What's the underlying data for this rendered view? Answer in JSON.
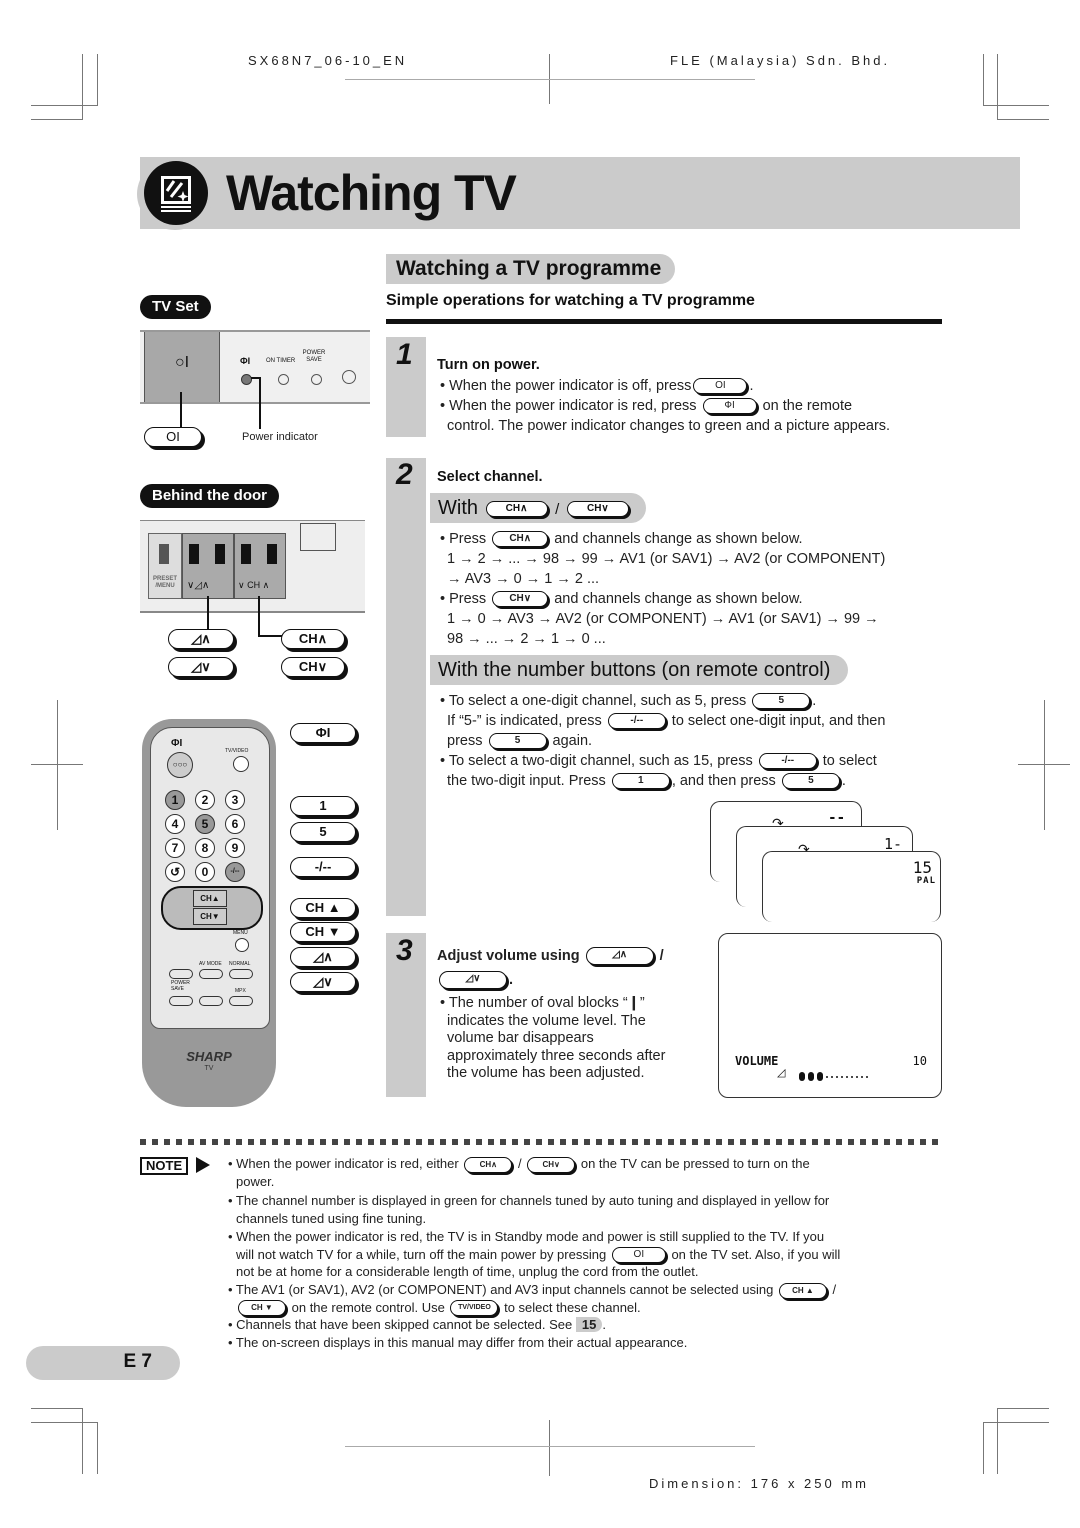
{
  "header": {
    "doc_code": "SX68N7_06-10_EN",
    "company": "FLE (Malaysia) Sdn. Bhd."
  },
  "banner": {
    "title": "Watching TV",
    "icon": "tv-guide-icon"
  },
  "section": {
    "title": "Watching a TV programme",
    "subtitle": "Simple operations for watching a TV programme"
  },
  "left": {
    "tv_set_label": "TV Set",
    "panel_labels": {
      "power": "○I",
      "standby": "ФI",
      "on_timer": "ON TIMER",
      "power_save": "POWER SAVE"
    },
    "main_power_key": "OI",
    "power_indicator_label": "Power indicator",
    "behind_door_label": "Behind the door",
    "door_labels": {
      "preset_menu": "PRESET /MENU",
      "vol": "∨◿∧",
      "ch": "∨ CH ∧"
    },
    "door_callouts": [
      "◿∧",
      "◿∨",
      "CH∧",
      "CH∨"
    ],
    "remote": {
      "standby": "ФI",
      "tv_video": "TV/VIDEO",
      "digits": [
        "1",
        "2",
        "3",
        "4",
        "5",
        "6",
        "7",
        "8",
        "9",
        "↺",
        "0",
        "-/--"
      ],
      "ch_up": "CH▲",
      "ch_down": "CH▼",
      "menu": "MENU",
      "mute": "🔇",
      "av_mode": "AV MODE",
      "normal": "NORMAL",
      "power_save": "POWER SAVE",
      "mpx": "MPX",
      "brand": "SHARP",
      "brand_sub": "TV"
    },
    "remote_callouts": [
      "ФI",
      "1",
      "5",
      "-/--",
      "CH ▲",
      "CH ▼",
      "◿∧",
      "◿∨"
    ]
  },
  "steps": [
    {
      "number": "1",
      "title": "Turn on power.",
      "lines": [
        {
          "pre": "• When the power indicator is off, press",
          "key": "OI",
          "post": "."
        },
        {
          "pre": "• When the power indicator is red, press",
          "key": "ФI",
          "post": "on the remote"
        },
        {
          "pre": "control. The power indicator changes to green and a picture appears.",
          "key": "",
          "post": ""
        }
      ]
    },
    {
      "number": "2",
      "title": "Select channel.",
      "with_bar": {
        "label": "With",
        "key1": "CH∧",
        "sep": "/",
        "key2": "CH∨"
      },
      "up_text": {
        "pre": "• Press",
        "key": "CH∧",
        "post": "and channels change as shown below."
      },
      "up_seq_1": "1 → 2 →  ... → 98 → 99 → AV1 (or SAV1) → AV2 (or COMPONENT)",
      "up_seq_2": "→ AV3 → 0 → 1 → 2 ...",
      "down_text": {
        "pre": "• Press",
        "key": "CH∨",
        "post": "and channels change as shown below."
      },
      "down_seq_1": "1 → 0 →  AV3 → AV2 (or COMPONENT) → AV1 (or SAV1)  → 99 →",
      "down_seq_2": "98 → ... → 2 → 1 → 0 ...",
      "number_bar": "With the number buttons (on remote control)",
      "num_lines": [
        {
          "pre": "• To select a one-digit channel, such as 5, press",
          "key": "5",
          "post": "."
        },
        {
          "pre": "If “5-” is indicated, press",
          "key": "-/--",
          "post": "to select one-digit input, and then"
        },
        {
          "pre": "press",
          "key": "5",
          "post": "again."
        },
        {
          "pre": "• To select a two-digit channel, such as 15, press",
          "key": "-/--",
          "post": "to select"
        },
        {
          "pre": "the two-digit input. Press",
          "key": "1",
          "post": ", and then press",
          "key2": "5",
          "post2": "."
        }
      ],
      "osd": {
        "screen1": "--",
        "screen2": "1-",
        "screen3": "15",
        "system": "PAL"
      }
    },
    {
      "number": "3",
      "title": "Adjust volume using",
      "key1": "◿∧",
      "sep": "/",
      "key2": "◿∨",
      "lines": [
        "• The number of oval blocks “❙”",
        "indicates the volume level. The",
        "volume bar disappears",
        "approximately three seconds after",
        "the volume has been adjusted."
      ],
      "osd": {
        "label": "VOLUME",
        "value": "10",
        "level_fraction": 0.25,
        "filled_blocks": 3,
        "total_blocks": 12
      }
    }
  ],
  "note": {
    "tag": "NOTE",
    "items": [
      {
        "html_parts": [
          "• When the power indicator is red, either",
          "CH∧",
          "/",
          "CH∨",
          "on the TV can be pressed to turn on the"
        ],
        "cont": "power."
      },
      {
        "text": "• The channel number is displayed in green for channels tuned by auto tuning and displayed in yellow for",
        "cont": "channels tuned using fine tuning."
      },
      {
        "text": "• When the power indicator is red, the TV is in Standby mode and power is still supplied to the TV. If you",
        "cont1_pre": "will not watch TV for a while, turn off the main power by pressing",
        "key": "OI",
        "cont1_post": "on the TV set. Also, if you will",
        "cont2": "not be at home for a considerable length of time, unplug the cord from the outlet."
      },
      {
        "text": "• The AV1 (or SAV1), AV2 (or COMPONENT) and AV3 input channels cannot be selected using",
        "key1": "CH ▲",
        "sep": "/",
        "key2": "CH ▼",
        "cont_mid": "on the remote control. Use",
        "key3": "TV/VIDEO",
        "cont_end": "to select these channel."
      },
      {
        "text": "• Channels that have been skipped cannot be selected. See",
        "page_ref": "15",
        "end": "."
      },
      {
        "text": "• The on-screen displays in this manual may differ from their actual appearance."
      }
    ]
  },
  "footer": {
    "page": "E 7",
    "dimension": "Dimension: 176 x 250 mm"
  }
}
